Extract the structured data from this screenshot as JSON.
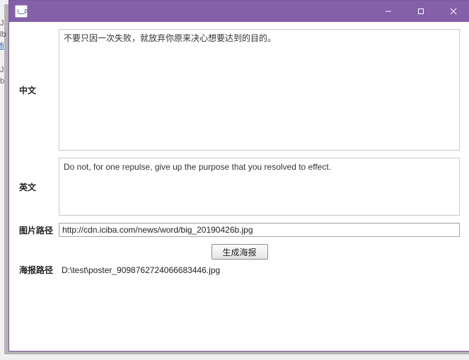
{
  "bg": {
    "l1": "J",
    "l2": "lb",
    "l3": "fi",
    "l4": "J",
    "l5": "b"
  },
  "titlebar": {
    "minimize_name": "minimize-button",
    "maximize_name": "maximize-button",
    "close_name": "close-button"
  },
  "labels": {
    "chinese": "中文",
    "english": "英文",
    "image_path": "图片路径",
    "poster_path": "海报路径"
  },
  "values": {
    "chinese_text": "不要只因一次失败，就放弃你原来决心想要达到的目的。",
    "english_text": "Do not, for one repulse, give up the purpose that you resolved to effect.",
    "image_path": "http://cdn.iciba.com/news/word/big_20190426b.jpg",
    "poster_output": "D:\\test\\poster_9098762724066683446.jpg"
  },
  "buttons": {
    "generate": "生成海报"
  }
}
